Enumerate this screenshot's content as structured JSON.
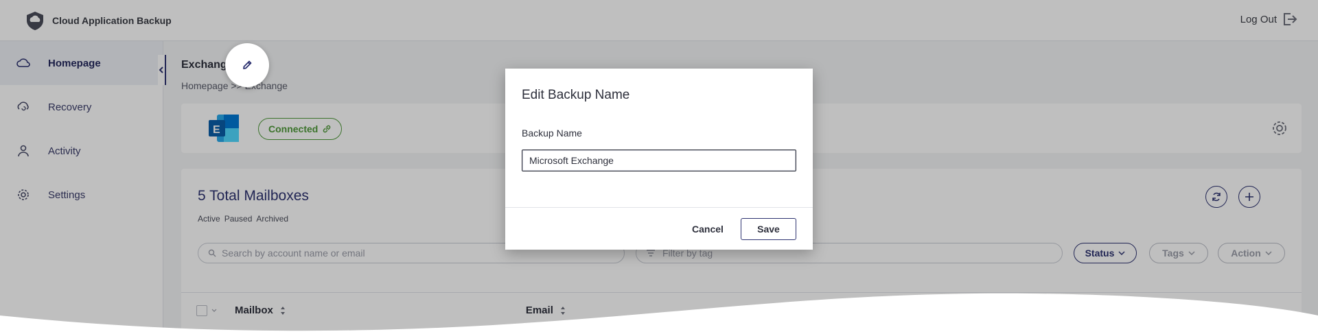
{
  "app": {
    "title": "Cloud Application Backup"
  },
  "header": {
    "logout_label": "Log Out"
  },
  "sidebar": {
    "items": [
      {
        "label": "Homepage",
        "icon": "cloud-icon",
        "active": true
      },
      {
        "label": "Recovery",
        "icon": "recovery-icon",
        "active": false
      },
      {
        "label": "Activity",
        "icon": "person-icon",
        "active": false
      },
      {
        "label": "Settings",
        "icon": "gear-icon",
        "active": false
      }
    ]
  },
  "page": {
    "title": "Exchange",
    "breadcrumb": "Homepage >> Exchange"
  },
  "app_card": {
    "logo_letter": "E",
    "status": "Connected",
    "status_color": "#4f9a3a"
  },
  "mailboxes": {
    "title": "5 Total Mailboxes",
    "filters": [
      "Active",
      "Paused",
      "Archived"
    ],
    "search_placeholder": "Search by account name or email",
    "tag_placeholder": "Filter by tag",
    "buttons": {
      "status": "Status",
      "tags": "Tags",
      "action": "Action"
    },
    "columns": [
      "Mailbox",
      "Email"
    ]
  },
  "modal": {
    "title": "Edit Backup Name",
    "field_label": "Backup Name",
    "field_value": "Microsoft Exchange",
    "cancel_label": "Cancel",
    "save_label": "Save"
  },
  "colors": {
    "accent": "#2d3270",
    "connected": "#4f9a3a"
  }
}
